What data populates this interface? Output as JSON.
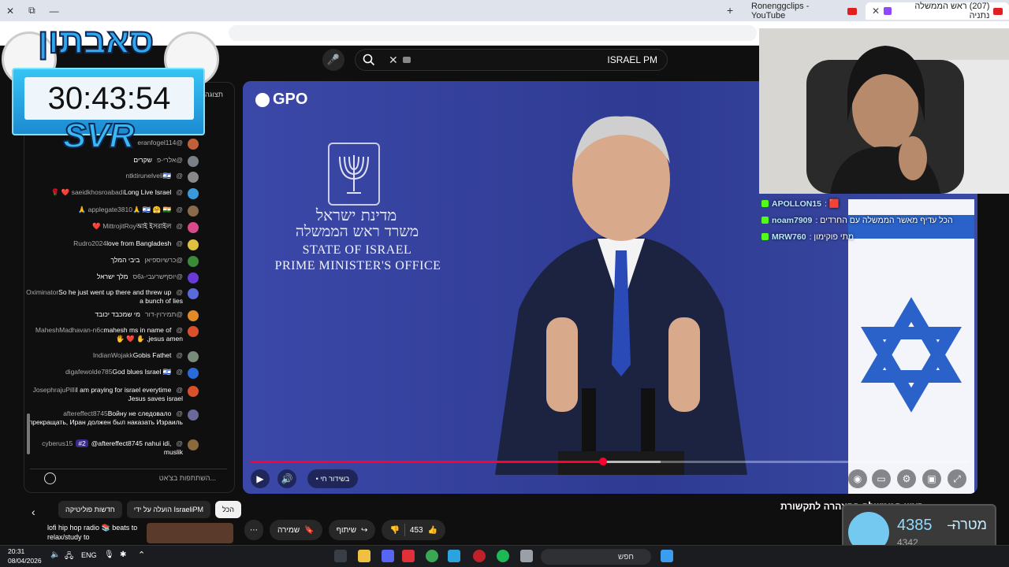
{
  "browser": {
    "tabs": [
      {
        "label": "Ronenggclips - YouTube",
        "active": false
      },
      {
        "label": "(207) ראש הממשלה נתניה",
        "active": true
      }
    ],
    "new_tab_symbol": "+"
  },
  "search": {
    "query": "ISRAEL PM",
    "clear_symbol": "✕",
    "search_symbol": "🔍",
    "mic_symbol": "🎤"
  },
  "overlay": {
    "timer": "30:43:54",
    "tag": "SVR",
    "logo": "סאבתון"
  },
  "chat": {
    "header": "תצוגה",
    "input_placeholder": "השתתפות בצ'אט...",
    "messages": [
      {
        "user": "@eranfogel114",
        "text": "",
        "color": "#c0603a"
      },
      {
        "user": "@אלרי-פ",
        "text": "שקרים",
        "color": "#7a8088"
      },
      {
        "user": "@ntktirunelveli",
        "text": "🇮🇱",
        "color": "#888"
      },
      {
        "user": "@saeidkhosroabadi",
        "text": "Long Live Israel ❤️ 🌹",
        "color": "#3a9ad9"
      },
      {
        "user": "@applegate3810",
        "text": "🙏 🇮🇱 🤗 🇮🇳 🙏",
        "color": "#8a6a4a"
      },
      {
        "user": "@MittrojitRoy",
        "text": "আই ইসরাইল ❤️",
        "color": "#d94a8a"
      },
      {
        "user": "@Rudro2024",
        "text": "love from Bangladesh",
        "color": "#e0c040"
      },
      {
        "user": "@כרשיוספיאן",
        "text": "ביבי המלך",
        "color": "#3a8a3a"
      },
      {
        "user": "@יוסףשרעבי-ג6ס",
        "text": "מלך ישראל",
        "color": "#6a3ad9"
      },
      {
        "user": "@Oximinator",
        "text": "So he just went up there and threw up a bunch of lies",
        "color": "#5a6ad9"
      },
      {
        "user": "@תמירוין-דור",
        "text": "מי שמכבד יכובד",
        "color": "#e08a2a"
      },
      {
        "user": "@MaheshMadhavan-n6c",
        "text": "mahesh ms in name of jesus amen, ✋ ❤️ 🖐",
        "color": "#d9502a"
      },
      {
        "user": "@IndianWojakk",
        "text": "Gobis Fathet",
        "color": "#7a8a7a"
      },
      {
        "user": "@digafewolde785",
        "text": "God blues Israel 🇮🇱",
        "color": "#2a6ad9"
      },
      {
        "user": "@JosephrajuPilli",
        "text": "I am praying for israel everytime Jesus saves israel",
        "color": "#d9502a"
      },
      {
        "user": "@aftereffect8745",
        "text": "Войну не следовало прекращать, Иран должен был наказать Израиль.",
        "color": "#6a6a9a"
      },
      {
        "user": "@cyberus15",
        "text": "@aftereffect8745 nahui idi, muslik",
        "badge": "#2",
        "color": "#8a6a3a"
      }
    ]
  },
  "player": {
    "live_label": "• בשידור חי",
    "progress": 0.49,
    "buffered": 0.57,
    "video_text": {
      "channel_mark": "GPO",
      "hebrew_1": "מדינת ישראל",
      "hebrew_2": "משרד ראש הממשלה",
      "english_1": "STATE OF ISRAEL",
      "english_2": "PRIME MINISTER'S OFFICE"
    }
  },
  "stream_chat": [
    {
      "user": "APOLLON15",
      "text": ": 🟥"
    },
    {
      "user": "noam7909",
      "text": ": הכל עדיף מאשר הממשלה עם החרדים"
    },
    {
      "user": "MRW760",
      "text": ": מתי פוקימון"
    }
  ],
  "below_video": {
    "title": "ראש הממשלה בהצהרה לתקשורת",
    "chips": [
      "הכל",
      "הועלה על ידי IsraeliPM",
      "חדשות פוליטיקה"
    ],
    "recommendation": "lofi hip hop radio 📚 beats to relax/study to",
    "likes": "453",
    "share_label": "שיתוף",
    "save_label": "שמירה",
    "more_symbol": "⋯"
  },
  "goal": {
    "label": "מטרה",
    "current": "4385",
    "target": "4342",
    "separator": "–"
  },
  "taskbar": {
    "time": "20:31",
    "date": "08/04/2026",
    "language": "ENG",
    "search_label": "חפש"
  }
}
